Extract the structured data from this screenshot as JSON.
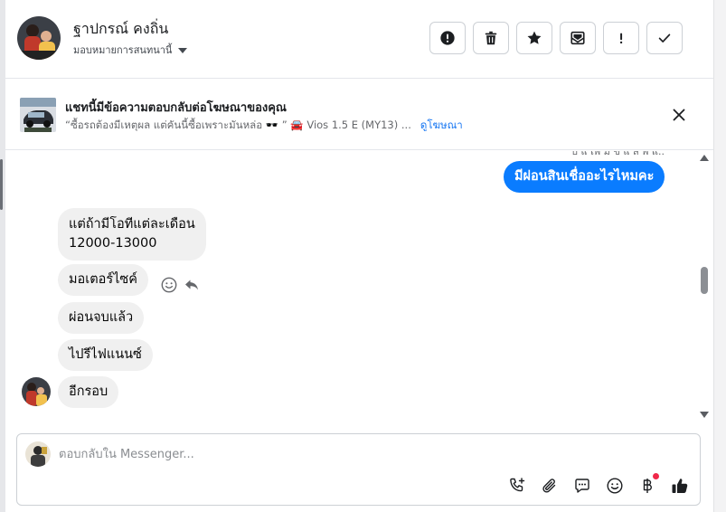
{
  "header": {
    "contact_name": "ฐาปกรณ์ คงถิ่น",
    "assign_label": "มอบหมายการสนทนานี้",
    "actions": [
      {
        "name": "mark-spam-button",
        "icon": "alert-circle-icon"
      },
      {
        "name": "delete-button",
        "icon": "trash-icon"
      },
      {
        "name": "star-button",
        "icon": "star-icon"
      },
      {
        "name": "mark-unread-button",
        "icon": "mail-icon"
      },
      {
        "name": "follow-up-button",
        "icon": "exclamation-icon"
      },
      {
        "name": "mark-done-button",
        "icon": "check-icon"
      }
    ]
  },
  "ad_context": {
    "title": "แชทนี้มีข้อความตอบกลับต่อโฆษณาของคุณ",
    "snippet": "“ซื้อรถต้องมีเหตุผล แต่คันนี้ซื้อเพราะมันหล่อ 🕶️ ” 🚘 Vios 1.5 E (MY13) ...",
    "link_label": "ดูโฆษณา"
  },
  "messages": {
    "prev_partial": "บ แ เพ ม ข แ ล พ แ.. ",
    "outgoing": "มีผ่อนสินเชื่ออะไรไหมคะ",
    "incoming": [
      "แต่ถ้ามีโอทีแต่ละเดือน",
      "12000-13000",
      "มอเตอร์ไซค์",
      "ผ่อนจบแล้ว",
      "ไปรีไฟแนนซ์",
      "อีกรอบ"
    ]
  },
  "composer": {
    "placeholder": "ตอบกลับใน Messenger..."
  },
  "colors": {
    "accent": "#0a7cff",
    "incoming_bubble": "#f0f0f0",
    "link": "#1877f2",
    "badge": "#f02849"
  }
}
